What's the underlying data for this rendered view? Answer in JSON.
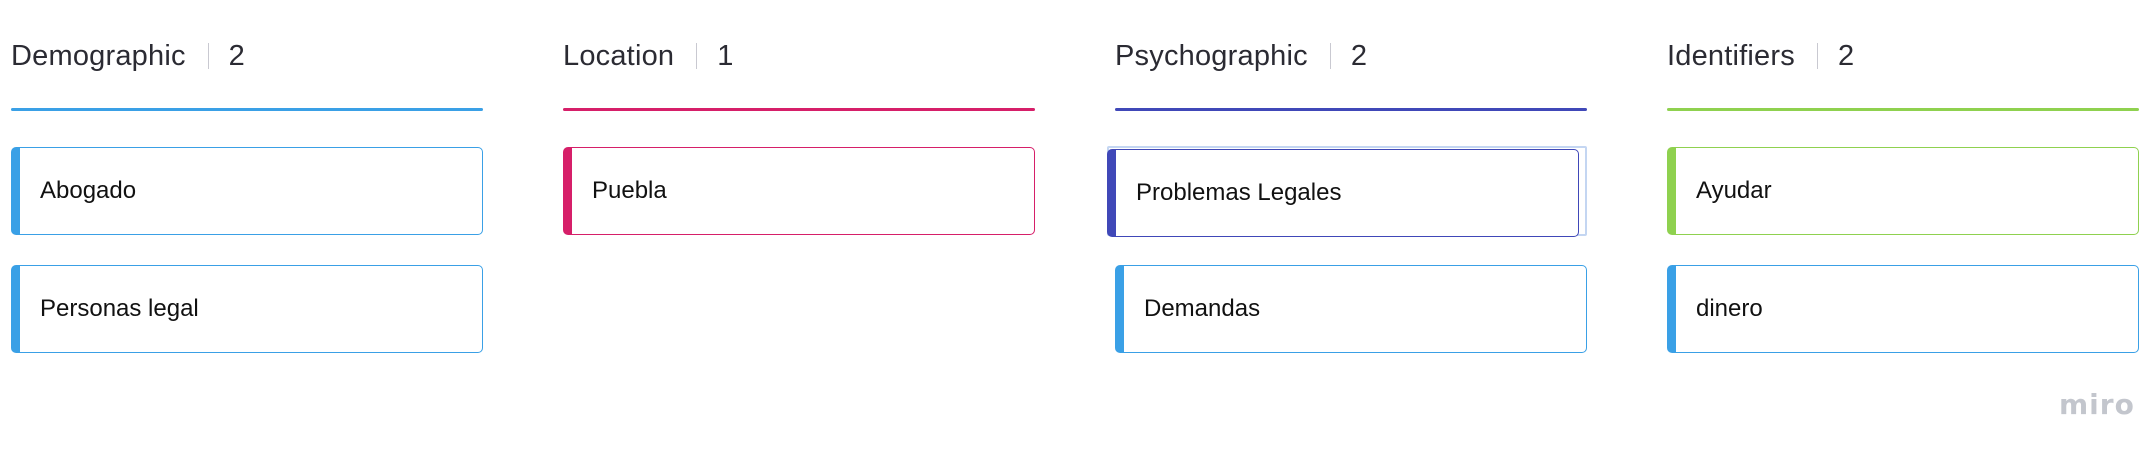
{
  "columns": [
    {
      "title": "Demographic",
      "count": "2",
      "color": "#3aa0e6",
      "cards": [
        {
          "label": "Abogado",
          "color": "#3aa0e6"
        },
        {
          "label": "Personas legal",
          "color": "#3aa0e6"
        }
      ]
    },
    {
      "title": "Location",
      "count": "1",
      "color": "#d61f69",
      "cards": [
        {
          "label": "Puebla",
          "color": "#d61f69"
        }
      ]
    },
    {
      "title": "Psychographic",
      "count": "2",
      "color": "#4048b8",
      "cards": [
        {
          "label": "Problemas Legales",
          "color": "#4048b8",
          "selected": true
        },
        {
          "label": "Demandas",
          "color": "#3aa0e6"
        }
      ]
    },
    {
      "title": "Identifiers",
      "count": "2",
      "color": "#8fd14f",
      "cards": [
        {
          "label": "Ayudar",
          "color": "#8fd14f"
        },
        {
          "label": "dinero",
          "color": "#3aa0e6"
        }
      ]
    }
  ],
  "watermark": {
    "text": "miro"
  }
}
